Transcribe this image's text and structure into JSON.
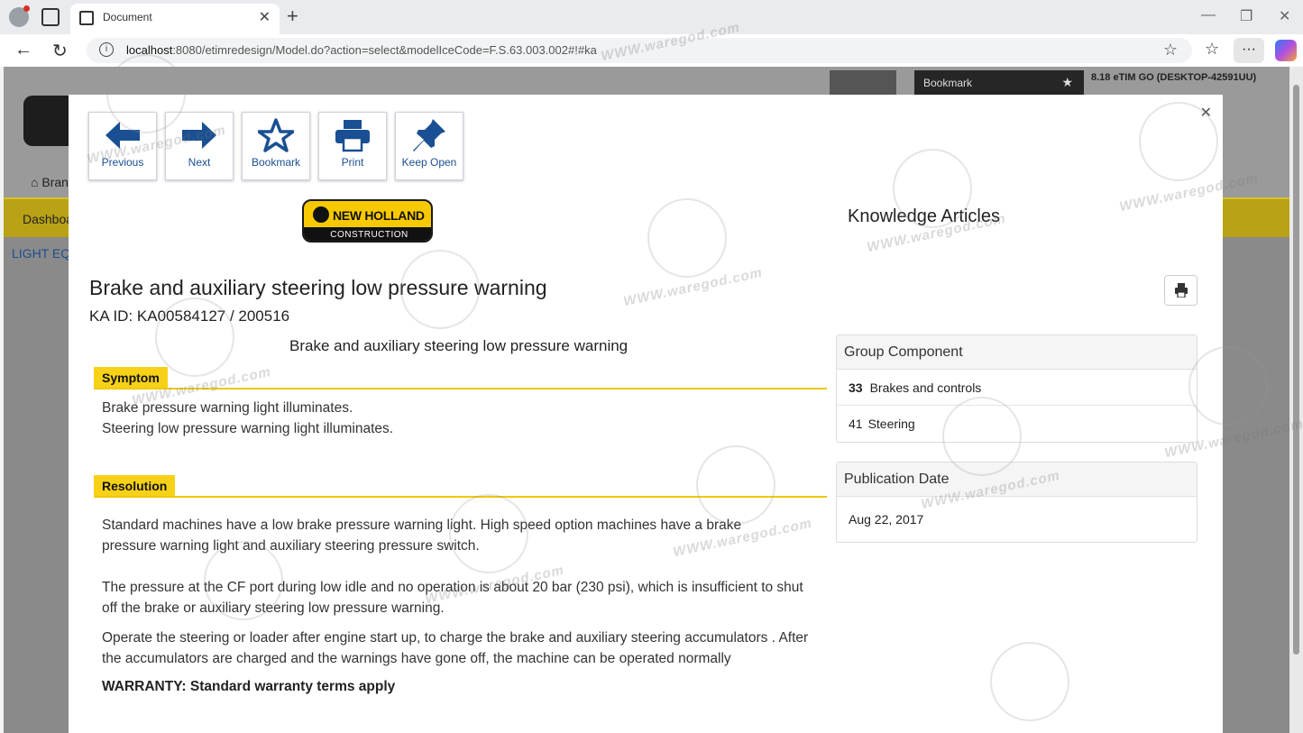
{
  "browser": {
    "tab_title": "Document",
    "url_host": "localhost",
    "url_rest": ":8080/etimredesign/Model.do?action=select&modelIceCode=F.S.63.003.002#!#ka"
  },
  "app": {
    "bookmark_label": "Bookmark",
    "user_info": "8.18 eTIM GO (DESKTOP-42591UU)",
    "brand_label": "Bran",
    "dashboard_label": "Dashboa",
    "light_eq_label": "LIGHT EQ"
  },
  "toolbar": {
    "previous": "Previous",
    "next": "Next",
    "bookmark": "Bookmark",
    "print": "Print",
    "keep_open": "Keep Open"
  },
  "logo": {
    "line1": "NEW HOLLAND",
    "line2": "CONSTRUCTION"
  },
  "article": {
    "title": "Brake and auxiliary steering low pressure warning",
    "ka_id": "KA ID: KA00584127 / 200516",
    "subtitle": "Brake and auxiliary steering low pressure warning",
    "symptom_label": "Symptom",
    "symptom_lines": [
      "Brake pressure warning light illuminates.",
      "Steering low pressure warning light illuminates."
    ],
    "resolution_label": "Resolution",
    "resolution_paragraphs": [
      "Standard machines have a low brake pressure warning light. High speed option machines have a brake pressure warning light and auxiliary steering pressure switch.",
      "The pressure at the CF port during low idle and no operation is about 20 bar (230 psi), which is insufficient to shut off the brake or auxiliary steering low pressure warning.",
      "Operate the steering or loader after engine start up, to charge the brake and auxiliary steering accumulators . After the accumulators are charged and the warnings have gone off, the machine can be operated normally"
    ],
    "warranty": "WARRANTY: Standard warranty terms apply"
  },
  "sidebar": {
    "heading": "Knowledge Articles",
    "group_component_label": "Group Component",
    "group_components": [
      {
        "code": "33",
        "name": "Brakes and controls"
      },
      {
        "code": "41",
        "name": "Steering"
      }
    ],
    "publication_date_label": "Publication Date",
    "publication_date": "Aug 22, 2017"
  },
  "watermark_text": "WWW.waregod.com",
  "colors": {
    "accent_yellow": "#f7d117",
    "link_blue": "#1a4f93"
  }
}
